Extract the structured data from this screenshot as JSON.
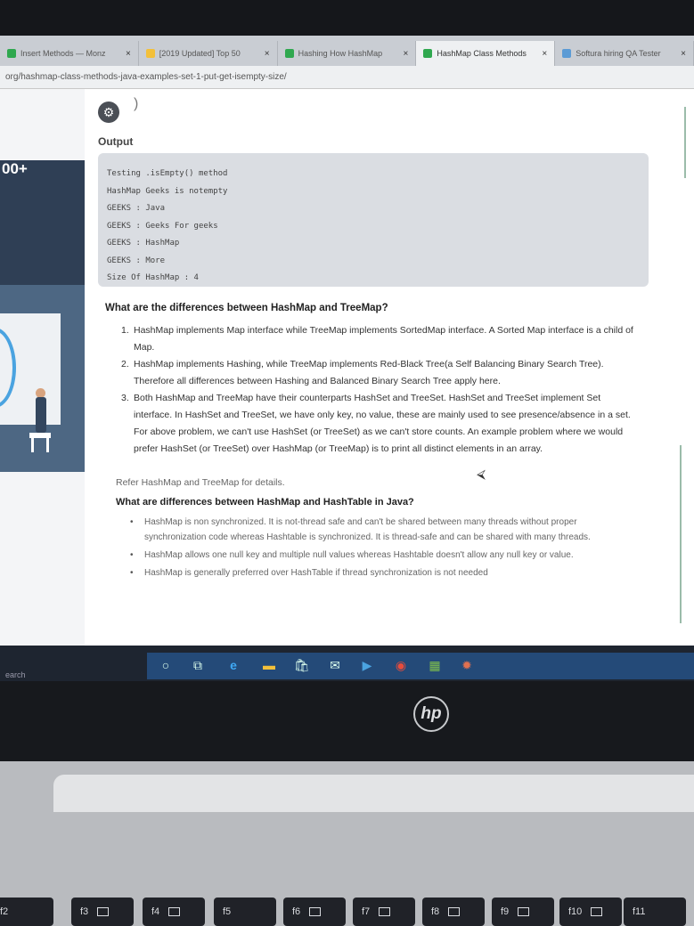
{
  "browser": {
    "tabs": [
      {
        "label": "Insert Methods — Monz",
        "favicon_color": "#2fa84f"
      },
      {
        "label": "[2019 Updated] Top 50",
        "favicon_color": "#f3c03a"
      },
      {
        "label": "Hashing How HashMap",
        "favicon_color": "#2fa84f"
      },
      {
        "label": "HashMap Class Methods",
        "favicon_color": "#2fa84f"
      },
      {
        "label": "Softura hiring QA Tester",
        "favicon_color": "#5b9bd5"
      }
    ],
    "url": "org/hashmap-class-methods-java-examples-set-1-put-get-isempty-size/"
  },
  "sidebar": {
    "stat": "00+"
  },
  "output": {
    "label": "Output",
    "lines": [
      "Testing .isEmpty() method",
      "HashMap Geeks is notempty",
      "GEEKS : Java",
      "GEEKS : Geeks For geeks",
      "GEEKS : HashMap",
      "GEEKS : More",
      "Size Of HashMap : 4"
    ]
  },
  "article": {
    "q1": "What are the differences between HashMap and TreeMap?",
    "q1_items": [
      {
        "num": "1.",
        "text": "HashMap implements Map interface while TreeMap implements SortedMap interface. A Sorted Map interface is a child of Map."
      },
      {
        "num": "2.",
        "text": "HashMap implements Hashing, while TreeMap implements Red-Black Tree(a Self Balancing Binary Search Tree). Therefore all differences between Hashing and Balanced Binary Search Tree apply here."
      },
      {
        "num": "3.",
        "text": "Both HashMap and TreeMap have their counterparts HashSet and TreeSet. HashSet and TreeSet implement Set interface. In HashSet and TreeSet, we have only key, no value, these are mainly used to see presence/absence in a set. For above problem, we can't use HashSet (or TreeSet) as we can't store counts. An example problem where we would prefer HashSet (or TreeSet) over HashMap (or TreeMap) is to print all distinct elements in an array."
      }
    ],
    "refer": "Refer HashMap and TreeMap for details.",
    "q2": "What are differences between HashMap and HashTable in Java?",
    "q2_items": [
      "HashMap is non synchronized. It is not-thread safe and can't be shared between many threads without proper synchronization code whereas Hashtable is synchronized. It is thread-safe and can be shared with many threads.",
      "HashMap allows one null key and multiple null values whereas Hashtable doesn't allow any null key or value.",
      "HashMap is generally preferred over HashTable if thread synchronization is not needed"
    ]
  },
  "taskbar": {
    "search_label": "earch",
    "icons": [
      "cortana-icon",
      "task-view-icon",
      "edge-icon",
      "file-explorer-icon",
      "store-icon",
      "mail-icon",
      "media-icon",
      "chrome-icon",
      "photos-icon",
      "settings-icon"
    ]
  },
  "laptop": {
    "logo": "hp",
    "fkeys": [
      "f2",
      "f3",
      "f4",
      "f5",
      "f6",
      "f7",
      "f8",
      "f9",
      "f10",
      "f11"
    ]
  }
}
